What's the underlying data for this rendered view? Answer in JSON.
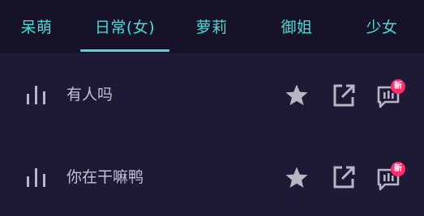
{
  "tabs": [
    {
      "label": "呆萌"
    },
    {
      "label": "日常(女)"
    },
    {
      "label": "萝莉"
    },
    {
      "label": "御姐"
    },
    {
      "label": "少女"
    }
  ],
  "active_tab": "日常(女)",
  "rows": [
    {
      "title": "有人吗",
      "badge": "新"
    },
    {
      "title": "你在干嘛鸭",
      "badge": "新"
    }
  ],
  "icons": {
    "leading": "equalizer-icon",
    "favorite": "star-icon",
    "share": "open-external-icon",
    "message": "chat-icon"
  },
  "colors": {
    "background": "#1e1a36",
    "tabbar": "#161328",
    "accent": "#4fd8d4",
    "text": "#c3c0cf",
    "icon": "#b8b5c4",
    "badge": "#ff2d6f"
  }
}
